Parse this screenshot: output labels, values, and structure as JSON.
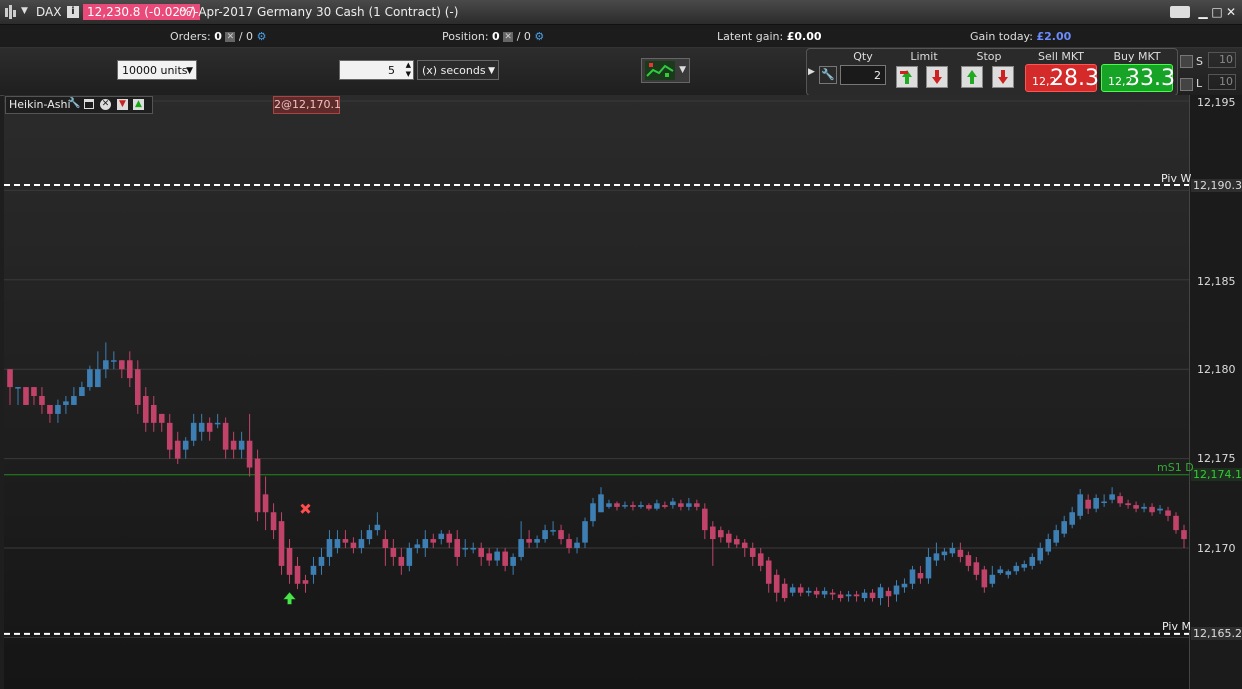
{
  "window": {
    "instrument": "DAX",
    "price_badge": "12,230.8 (-0.02%)",
    "title": "07-Apr-2017 Germany 30 Cash (1 Contract) (-)",
    "info_icon": "info-icon"
  },
  "status": {
    "orders_label": "Orders:",
    "orders_count": "0",
    "orders_sep": "/ 0",
    "position_label": "Position:",
    "position_count": "0",
    "position_sep": "/ 0",
    "latent_label": "Latent gain:",
    "latent_value": "£0.00",
    "gain_today_label": "Gain today:",
    "gain_today_value": "£2.00"
  },
  "toolbar": {
    "units_value": "10000 units",
    "interval_value": "5",
    "interval_unit": "(x) seconds"
  },
  "trade": {
    "qty_label": "Qty",
    "qty_value": "2",
    "limit_label": "Limit",
    "stop_label": "Stop",
    "sell_label": "Sell MKT",
    "buy_label": "Buy MKT",
    "sell_small": "12,2",
    "sell_big": "28.3",
    "buy_small": "12,2",
    "buy_big": "33.3",
    "s_label": "S",
    "l_label": "L",
    "s_value": "10",
    "l_value": "10"
  },
  "chart": {
    "study_label": "Heikin-Ashi",
    "order_tag": "2@12,170.1",
    "piv_w_label": "Piv W",
    "piv_m_label": "Piv M",
    "ms1_label": "mS1 D",
    "piv_w_value": "12,190.3",
    "piv_m_value": "12,165.2",
    "ms1_value": "12,174.1",
    "y_ticks": [
      "12,195",
      "12,185",
      "12,180",
      "12,175",
      "12,170"
    ],
    "colors": {
      "up": "#3d7fb3",
      "down": "#c2436a",
      "pivot": "#ffffff",
      "ms1": "#1e8a1e"
    }
  },
  "chart_data": {
    "type": "candlestick",
    "ylim": [
      12164,
      12195
    ],
    "candles": [
      [
        12180,
        12179,
        12180,
        12178
      ],
      [
        12179,
        12179,
        12179,
        12178
      ],
      [
        12179,
        12178,
        12179,
        12178
      ],
      [
        12179,
        12178.5,
        12179,
        12178
      ],
      [
        12178.5,
        12178,
        12179,
        12177.5
      ],
      [
        12178,
        12177.5,
        12178,
        12177
      ],
      [
        12177.5,
        12178,
        12178.3,
        12177
      ],
      [
        12178,
        12178.2,
        12178.5,
        12177.5
      ],
      [
        12178,
        12178.5,
        12179,
        12178
      ],
      [
        12178.5,
        12179,
        12179.3,
        12178.5
      ],
      [
        12179,
        12180,
        12180.2,
        12178.8
      ],
      [
        12179,
        12180,
        12181,
        12179
      ],
      [
        12180,
        12180.5,
        12181.5,
        12179.5
      ],
      [
        12180.5,
        12180.5,
        12181,
        12180
      ],
      [
        12180.5,
        12180,
        12180.5,
        12179.5
      ],
      [
        12180.5,
        12179.5,
        12181,
        12179
      ],
      [
        12180,
        12178,
        12180.5,
        12177.5
      ],
      [
        12178.5,
        12177,
        12179,
        12176.5
      ],
      [
        12178,
        12177,
        12178.5,
        12176.5
      ],
      [
        12177.5,
        12177,
        12177.5,
        12176.5
      ],
      [
        12177,
        12175.5,
        12177.5,
        12175
      ],
      [
        12176,
        12175,
        12176.5,
        12174.7
      ],
      [
        12175.5,
        12176,
        12176.2,
        12175
      ],
      [
        12176,
        12177,
        12177.5,
        12175.7
      ],
      [
        12176.5,
        12177,
        12177.5,
        12176
      ],
      [
        12177,
        12176.5,
        12177.3,
        12176
      ],
      [
        12177,
        12177,
        12177.5,
        12176.7
      ],
      [
        12177,
        12175.5,
        12177.3,
        12175
      ],
      [
        12176,
        12175.5,
        12176.5,
        12175
      ],
      [
        12175.5,
        12176,
        12176.5,
        12175
      ],
      [
        12176,
        12174.5,
        12177.5,
        12174
      ],
      [
        12175,
        12172,
        12175.5,
        12171.5
      ],
      [
        12173,
        12172,
        12174,
        12171
      ],
      [
        12172,
        12171,
        12172.5,
        12170.5
      ],
      [
        12171.5,
        12169,
        12172,
        12168.5
      ],
      [
        12170,
        12168.5,
        12170.5,
        12168
      ],
      [
        12169,
        12168,
        12169.5,
        12167.7
      ],
      [
        12168.2,
        12168,
        12168.5,
        12167.5
      ],
      [
        12168.5,
        12169,
        12169.5,
        12168
      ],
      [
        12169,
        12169.5,
        12170,
        12168.5
      ],
      [
        12169.5,
        12170.5,
        12171,
        12169
      ],
      [
        12170,
        12170.5,
        12171,
        12169.7
      ],
      [
        12170.5,
        12170.3,
        12171,
        12170
      ],
      [
        12170.3,
        12170,
        12170.6,
        12169.7
      ],
      [
        12170,
        12170.5,
        12171,
        12169.7
      ],
      [
        12170.5,
        12171,
        12171.3,
        12170.2
      ],
      [
        12171,
        12171.3,
        12172,
        12170.7
      ],
      [
        12170.5,
        12170,
        12171,
        12169
      ],
      [
        12170,
        12169.5,
        12170.5,
        12169
      ],
      [
        12169.5,
        12169,
        12170,
        12168.5
      ],
      [
        12169,
        12170,
        12170.3,
        12168.7
      ],
      [
        12170,
        12170.2,
        12170.5,
        12169.7
      ],
      [
        12170,
        12170.5,
        12171,
        12169.5
      ],
      [
        12170.5,
        12170.3,
        12170.8,
        12170
      ],
      [
        12170.5,
        12170.8,
        12171,
        12170.2
      ],
      [
        12170.8,
        12170.3,
        12171,
        12170
      ],
      [
        12170.5,
        12169.5,
        12171,
        12169
      ],
      [
        12170,
        12170,
        12170.5,
        12169.5
      ],
      [
        12170,
        12170,
        12170.3,
        12169.7
      ],
      [
        12170,
        12169.5,
        12170.3,
        12169
      ],
      [
        12169.7,
        12169.3,
        12170,
        12169
      ],
      [
        12169.3,
        12169.8,
        12170,
        12169
      ],
      [
        12169.8,
        12169,
        12170,
        12168.7
      ],
      [
        12169,
        12169.5,
        12169.7,
        12168.5
      ],
      [
        12169.5,
        12170.5,
        12171.5,
        12169.3
      ],
      [
        12170.5,
        12170.3,
        12171,
        12170
      ],
      [
        12170.3,
        12170.5,
        12170.7,
        12170
      ],
      [
        12170.5,
        12171,
        12171.3,
        12170.3
      ],
      [
        12171,
        12171,
        12171.5,
        12170.7
      ],
      [
        12171,
        12170.5,
        12171.3,
        12170.2
      ],
      [
        12170.5,
        12170,
        12170.8,
        12169.7
      ],
      [
        12170,
        12170.3,
        12170.6,
        12169.7
      ],
      [
        12170.3,
        12171.5,
        12171.7,
        12170
      ],
      [
        12171.5,
        12172.5,
        12172.8,
        12171.2
      ],
      [
        12172,
        12173,
        12173.4,
        12172
      ],
      [
        12172.3,
        12172.5,
        12172.7,
        12172.2
      ],
      [
        12172.5,
        12172.3,
        12172.6,
        12172.1
      ],
      [
        12172.4,
        12172.4,
        12172.6,
        12172.2
      ],
      [
        12172.4,
        12172.3,
        12172.6,
        12172.1
      ],
      [
        12172.3,
        12172.4,
        12172.6,
        12172.2
      ],
      [
        12172.4,
        12172.2,
        12172.5,
        12172.1
      ],
      [
        12172.2,
        12172.5,
        12172.7,
        12172.1
      ],
      [
        12172.4,
        12172.3,
        12172.6,
        12172.2
      ],
      [
        12172.4,
        12172.6,
        12172.8,
        12172.2
      ],
      [
        12172.5,
        12172.3,
        12172.7,
        12172.1
      ],
      [
        12172.3,
        12172.5,
        12172.8,
        12172.1
      ],
      [
        12172.5,
        12172.3,
        12172.7,
        12172.1
      ],
      [
        12172.2,
        12171,
        12172.5,
        12170.5
      ],
      [
        12171.2,
        12170.5,
        12171.5,
        12169
      ],
      [
        12171,
        12170.6,
        12171.2,
        12170.3
      ],
      [
        12170.8,
        12170.3,
        12171,
        12170
      ],
      [
        12170.5,
        12170.2,
        12170.7,
        12170
      ],
      [
        12170.3,
        12170,
        12170.5,
        12169.5
      ],
      [
        12170,
        12169.5,
        12170.3,
        12169
      ],
      [
        12169.7,
        12169,
        12170,
        12168.7
      ],
      [
        12169.3,
        12168,
        12169.5,
        12167.5
      ],
      [
        12168.5,
        12167.5,
        12168.8,
        12167
      ],
      [
        12168,
        12167.2,
        12168.3,
        12167
      ],
      [
        12167.5,
        12167.8,
        12168,
        12167.3
      ],
      [
        12167.8,
        12167.5,
        12168,
        12167.3
      ],
      [
        12167.5,
        12167.6,
        12167.8,
        12167.3
      ],
      [
        12167.6,
        12167.4,
        12167.8,
        12167.2
      ],
      [
        12167.4,
        12167.6,
        12167.8,
        12167.2
      ],
      [
        12167.5,
        12167.4,
        12167.7,
        12167.1
      ],
      [
        12167.4,
        12167.2,
        12167.6,
        12167
      ],
      [
        12167.3,
        12167.4,
        12167.6,
        12167
      ],
      [
        12167.4,
        12167.3,
        12167.6,
        12167
      ],
      [
        12167.2,
        12167.5,
        12167.7,
        12167
      ],
      [
        12167.5,
        12167.2,
        12167.7,
        12167
      ],
      [
        12167.2,
        12167.8,
        12168,
        12166.8
      ],
      [
        12167.6,
        12167.3,
        12167.8,
        12166.7
      ],
      [
        12167.4,
        12167.9,
        12168.2,
        12167
      ],
      [
        12167.8,
        12168,
        12168.3,
        12167.5
      ],
      [
        12168,
        12168.8,
        12169,
        12167.7
      ],
      [
        12168.6,
        12168.3,
        12169,
        12168
      ],
      [
        12168.3,
        12169.5,
        12170,
        12168
      ],
      [
        12169.3,
        12169.7,
        12170.3,
        12169
      ],
      [
        12169.6,
        12169.8,
        12170,
        12169.3
      ],
      [
        12169.7,
        12170,
        12170.3,
        12169.5
      ],
      [
        12169.9,
        12169.5,
        12170.3,
        12169.2
      ],
      [
        12169.6,
        12169,
        12169.8,
        12168.7
      ],
      [
        12169.2,
        12168.5,
        12169.5,
        12168.2
      ],
      [
        12168.8,
        12167.8,
        12169,
        12167.5
      ],
      [
        12168,
        12168.5,
        12169,
        12167.8
      ],
      [
        12168.6,
        12168.8,
        12169,
        12168.5
      ],
      [
        12168.5,
        12168.7,
        12168.8,
        12168.3
      ],
      [
        12168.7,
        12169,
        12169.2,
        12168.5
      ],
      [
        12168.9,
        12169.1,
        12169.3,
        12168.7
      ],
      [
        12169,
        12169.5,
        12169.7,
        12168.8
      ],
      [
        12169.3,
        12170,
        12170.3,
        12169.1
      ],
      [
        12169.8,
        12170.5,
        12170.8,
        12169.6
      ],
      [
        12170.3,
        12171,
        12171.3,
        12170.1
      ],
      [
        12170.8,
        12171.5,
        12171.8,
        12170.6
      ],
      [
        12171.3,
        12172,
        12172.3,
        12171.1
      ],
      [
        12171.8,
        12173,
        12173.3,
        12171.6
      ],
      [
        12172.7,
        12172.2,
        12173,
        12171.9
      ],
      [
        12172.2,
        12172.8,
        12173,
        12172
      ],
      [
        12172.6,
        12172.6,
        12173,
        12172.3
      ],
      [
        12172.7,
        12173,
        12173.4,
        12172.5
      ],
      [
        12172.9,
        12172.5,
        12173.1,
        12172.3
      ],
      [
        12172.5,
        12172.4,
        12172.7,
        12172.2
      ],
      [
        12172.4,
        12172.2,
        12172.6,
        12172
      ],
      [
        12172.2,
        12172.3,
        12172.5,
        12172
      ],
      [
        12172.3,
        12172,
        12172.5,
        12171.8
      ],
      [
        12172.1,
        12172.2,
        12172.4,
        12171.9
      ],
      [
        12172.1,
        12171.8,
        12172.3,
        12171.5
      ],
      [
        12171.8,
        12171,
        12172,
        12170.8
      ],
      [
        12171,
        12170.5,
        12171.3,
        12170
      ]
    ]
  }
}
